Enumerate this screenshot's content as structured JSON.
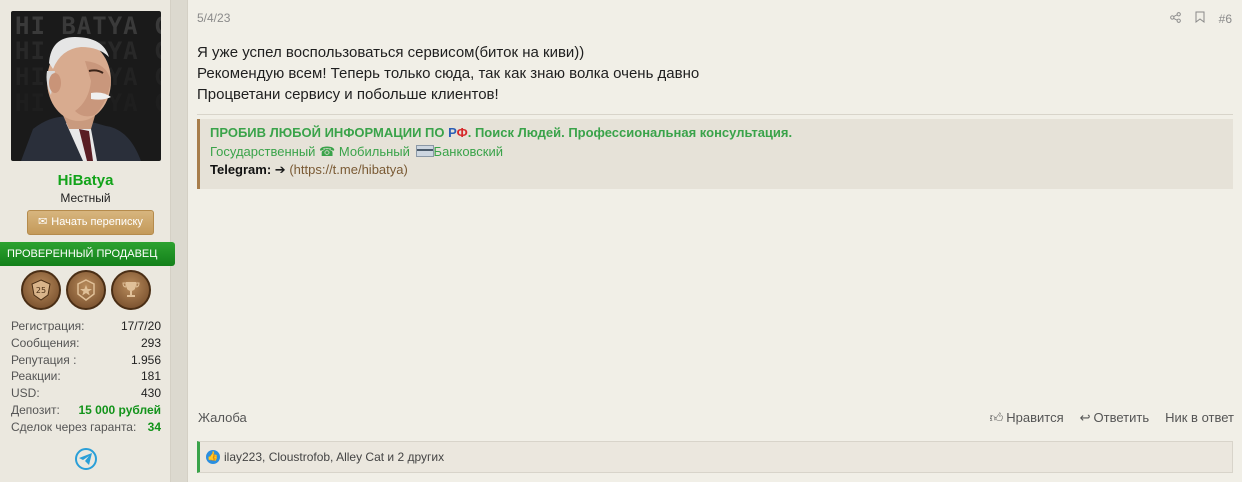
{
  "user": {
    "avatar_text": "HI BATYA СЕРВИС",
    "username": "HiBatya",
    "title": "Местный",
    "message_button": "Начать переписку",
    "verified_label": "ПРОВЕРЕННЫЙ ПРОДАВЕЦ ",
    "badges": [
      "25",
      "",
      ""
    ],
    "stats": [
      {
        "label": "Регистрация:",
        "value": "17/7/20",
        "green": false
      },
      {
        "label": "Сообщения:",
        "value": "293",
        "green": false
      },
      {
        "label": "Репутация :",
        "value": "1.956",
        "green": false
      },
      {
        "label": "Реакции:",
        "value": "181",
        "green": false
      },
      {
        "label": "USD:",
        "value": "430",
        "green": false
      },
      {
        "label": "Депозит:",
        "value": "15 000 рублей",
        "green": true
      },
      {
        "label": "Сделок через гаранта:",
        "value": "34",
        "green": true
      }
    ]
  },
  "post": {
    "date": "5/4/23",
    "number": "#6",
    "body": [
      "Я уже успел воспользоваться сервисом(биток на киви))",
      "Рекомендую всем! Теперь только сюда, так как знаю волка очень давно",
      "Процветани сервису и побольше клиентов!"
    ],
    "signature": {
      "headline_pre": "ПРОБИВ ЛЮБОЙ ИНФОРМАЦИИ ПО ",
      "rf_r": "Р",
      "rf_f": "Ф",
      "headline_post": ". Поиск Людей. Профессиональная консультация.",
      "item1": " Государственный",
      "item2": "☎ Мобильный",
      "item3": "Банковский",
      "telegram_label": "Telegram:",
      "telegram_arrow": "➔",
      "telegram_link": "(https://t.me/hibatya)"
    },
    "footer": {
      "report": "Жалоба",
      "like": "Нравится",
      "reply": "Ответить",
      "nick_reply": "Ник в ответ"
    },
    "reactions": "ilay223, Cloustrofob, Alley Cat и 2 других"
  }
}
